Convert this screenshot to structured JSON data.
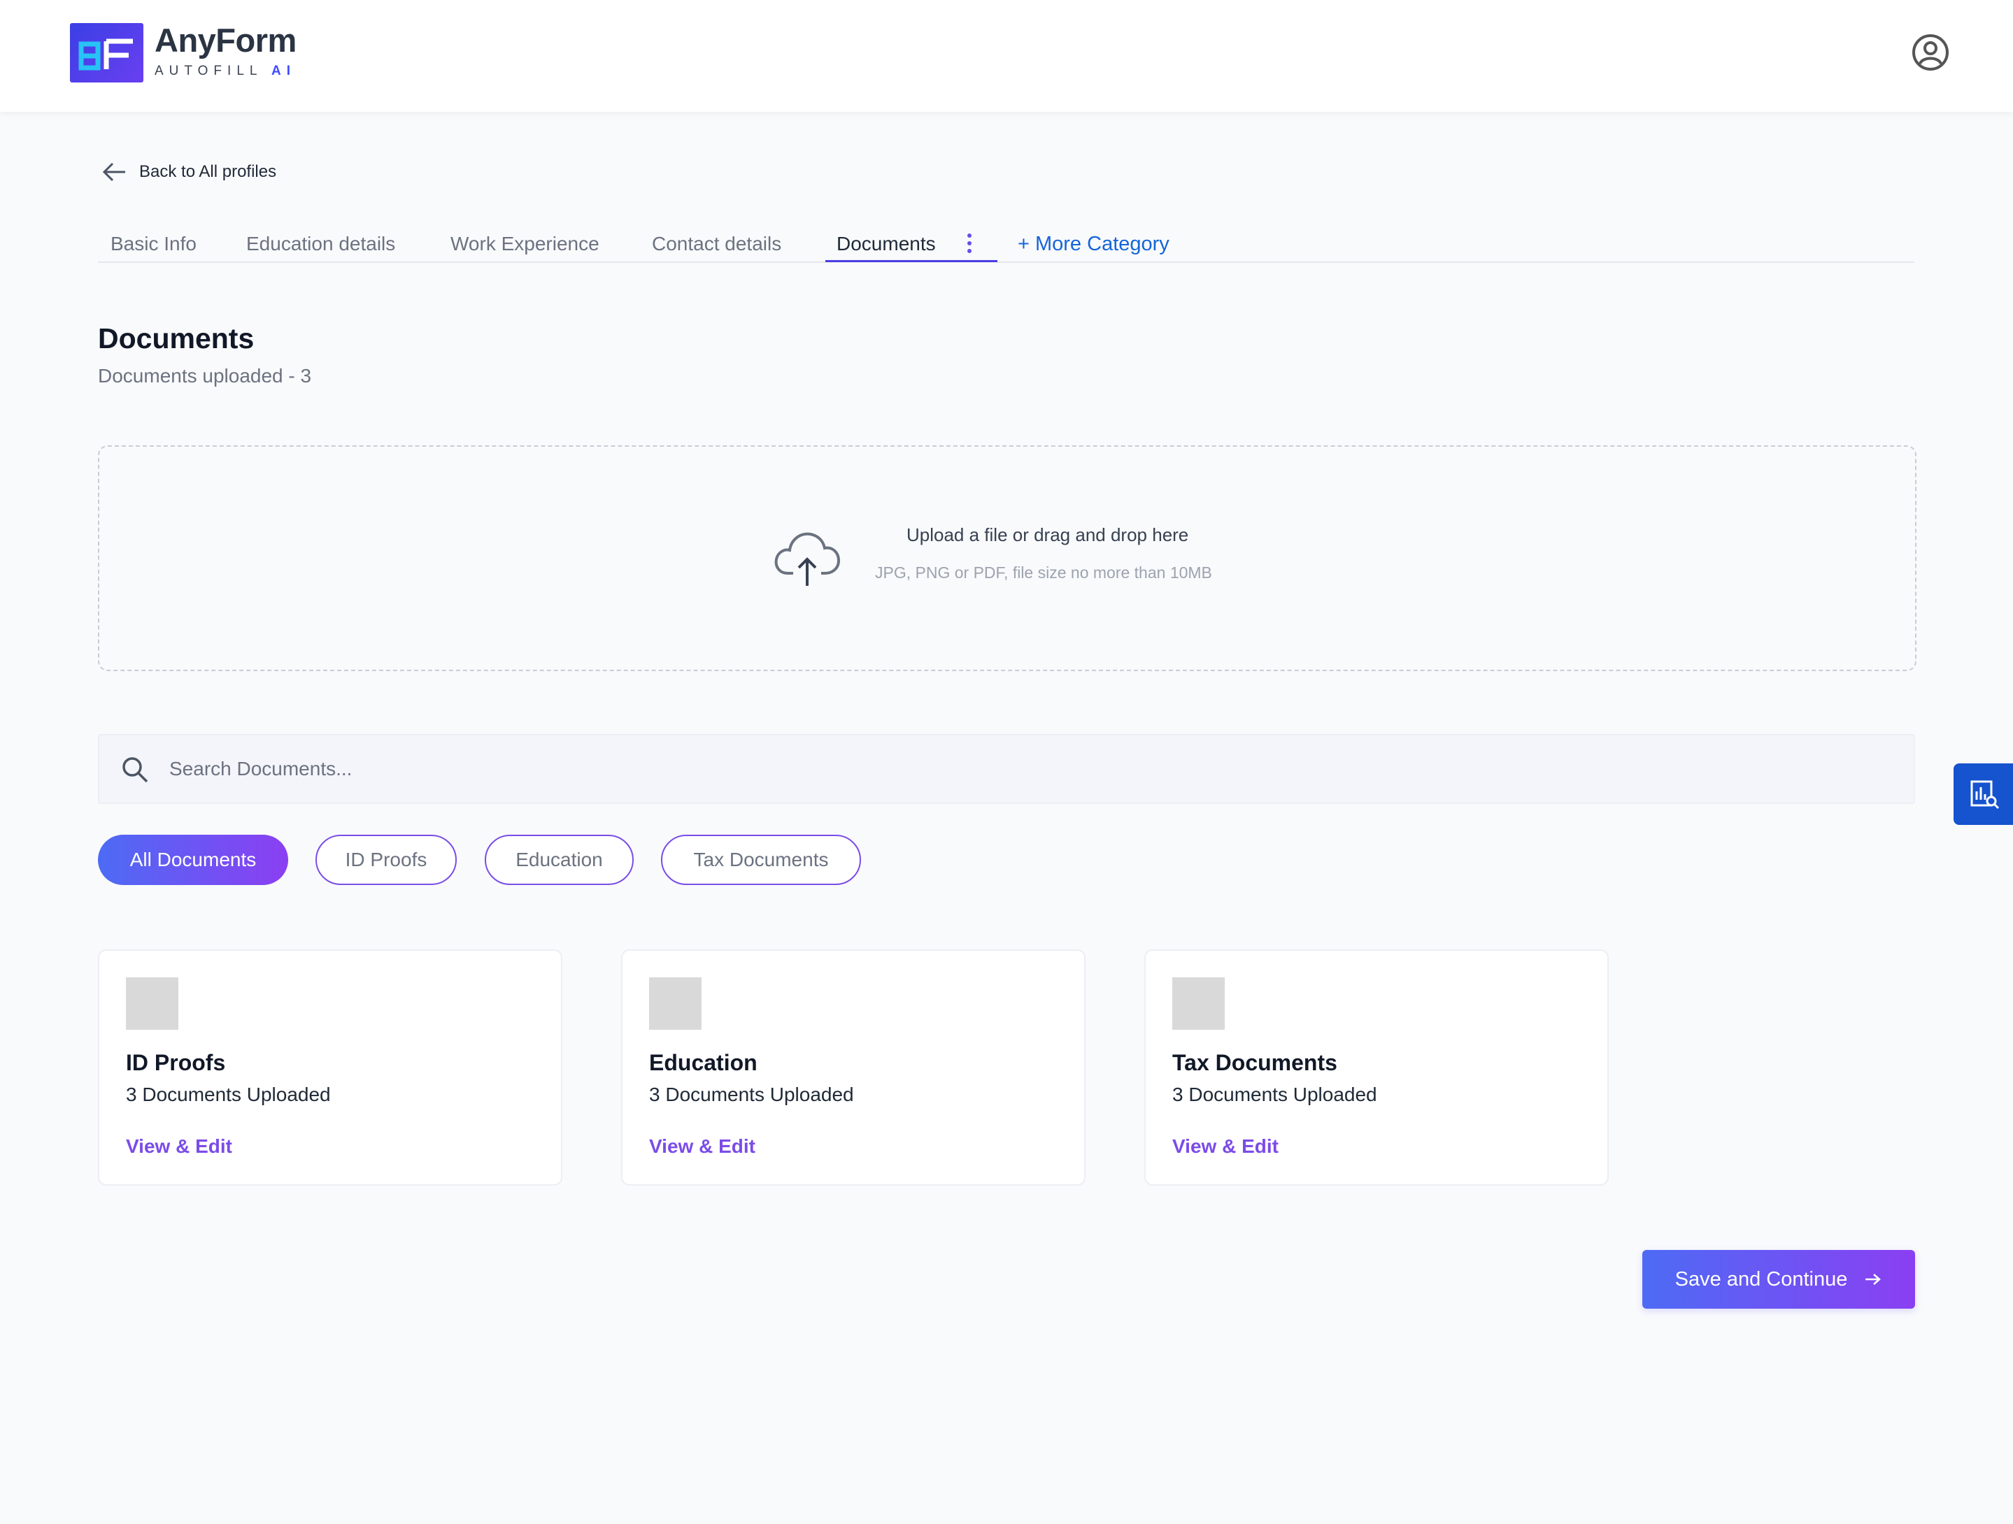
{
  "app": {
    "logo_text": "AnyForm",
    "logo_sub_main": "AUTOFILL",
    "logo_sub_accent": "AI",
    "logo_mark": "aF"
  },
  "header": {
    "profile_icon": "user-circle-icon"
  },
  "nav": {
    "back_label": "Back to All profiles",
    "tabs": [
      {
        "label": "Basic Info",
        "active": false
      },
      {
        "label": "Education details",
        "active": false
      },
      {
        "label": "Work Experience",
        "active": false
      },
      {
        "label": "Contact details",
        "active": false
      },
      {
        "label": "Documents",
        "active": true
      }
    ],
    "more_category_label": "+ More Category"
  },
  "page": {
    "title": "Documents",
    "subtitle": "Documents uploaded - 3"
  },
  "upload": {
    "title": "Upload a file or drag and drop here",
    "hint": "JPG, PNG or PDF, file size no more than 10MB"
  },
  "search": {
    "placeholder": "Search Documents...",
    "value": ""
  },
  "filters": [
    {
      "label": "All Documents",
      "active": true
    },
    {
      "label": "ID Proofs",
      "active": false
    },
    {
      "label": "Education",
      "active": false
    },
    {
      "label": "Tax Documents",
      "active": false
    }
  ],
  "cards": [
    {
      "title": "ID Proofs",
      "count": "3 Documents Uploaded",
      "link": "View & Edit"
    },
    {
      "title": "Education",
      "count": "3 Documents Uploaded",
      "link": "View & Edit"
    },
    {
      "title": "Tax Documents",
      "count": "3 Documents Uploaded",
      "link": "View & Edit"
    }
  ],
  "actions": {
    "save_label": "Save and Continue"
  },
  "colors": {
    "accent_purple": "#7b4ce8",
    "accent_blue": "#1565d8",
    "side_tab": "#1553cf",
    "gradient_start": "#4d6bf5",
    "gradient_end": "#8b3ff2"
  }
}
